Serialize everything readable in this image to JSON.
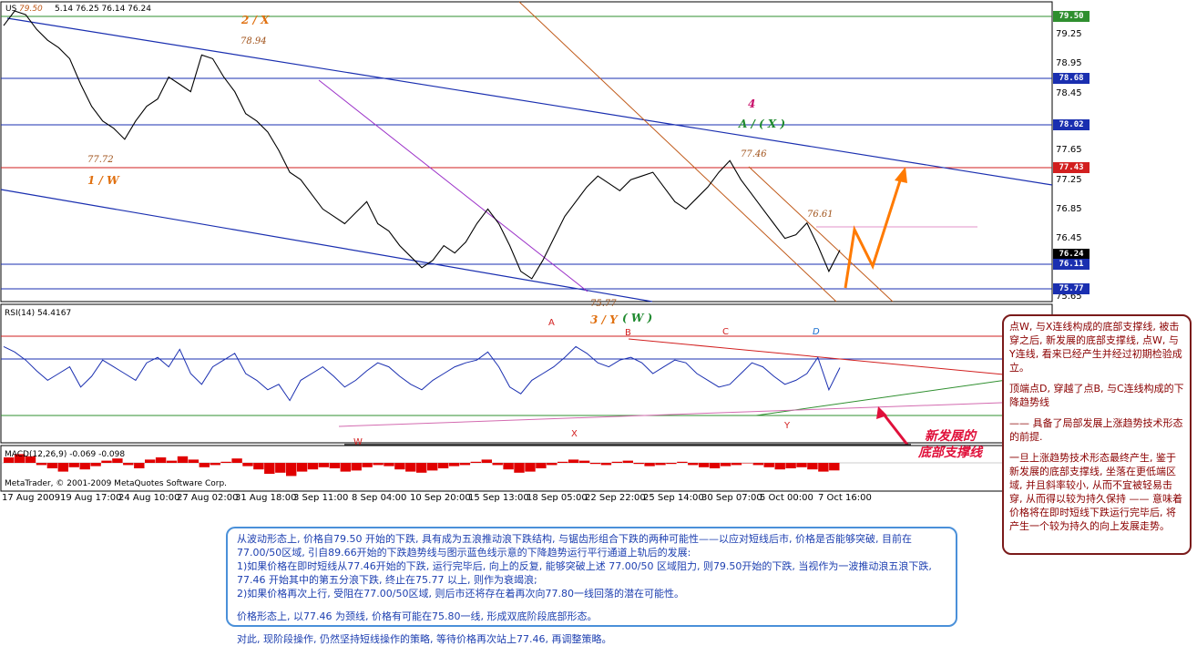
{
  "header": {
    "symbol": "US",
    "quote": "5.14 76.25 76.14 76.24",
    "high_mark": "79.50"
  },
  "price_axis": {
    "ticks": [
      "79.25",
      "78.95",
      "78.45",
      "77.65",
      "77.25",
      "76.85",
      "76.45",
      "75.65"
    ],
    "tags": [
      {
        "label": "79.50",
        "value": 79.5,
        "color": "#2f8f2f"
      },
      {
        "label": "78.68",
        "value": 78.68,
        "color": "#1a2fb0"
      },
      {
        "label": "78.02",
        "value": 78.02,
        "color": "#1a2fb0"
      },
      {
        "label": "77.43",
        "value": 77.43,
        "color": "#d21f1f"
      },
      {
        "label": "76.24",
        "value": 76.24,
        "color": "#000000"
      },
      {
        "label": "76.11",
        "value": 76.11,
        "color": "#1a2fb0"
      },
      {
        "label": "75.77",
        "value": 75.77,
        "color": "#1a2fb0"
      }
    ]
  },
  "wave_labels": {
    "two_x": "2 / X",
    "p7894": "78.94",
    "p7772": "77.72",
    "one_w": "1 / W",
    "four": "4",
    "a_x": "A / ( X )",
    "p7746": "77.46",
    "p7661": "76.61",
    "p7577": "75.77",
    "three_y": "3 / Y",
    "w_paren": "( W )"
  },
  "rsi": {
    "title": "RSI(14) 54.4167",
    "labels": {
      "A": "A",
      "B": "B",
      "C": "C",
      "D": "D",
      "W": "W",
      "X": "X",
      "Y": "Y"
    }
  },
  "macd": {
    "title": "MACD(12,26,9) -0.069 -0.098",
    "copyright": "MetaTrader, © 2001-2009 MetaQuotes Software Corp."
  },
  "time_axis": [
    "17 Aug 2009",
    "19 Aug 17:00",
    "24 Aug 10:00",
    "27 Aug 02:00",
    "31 Aug 18:00",
    "3 Sep 11:00",
    "8 Sep 04:00",
    "10 Sep 20:00",
    "15 Sep 13:00",
    "18 Sep 05:00",
    "22 Sep 22:00",
    "25 Sep 14:00",
    "30 Sep 07:00",
    "5 Oct 00:00",
    "7 Oct 16:00"
  ],
  "callout": {
    "line1": "新发展的",
    "line2": "底部支撑线"
  },
  "right_notes": [
    "点W, 与X连线构成的底部支撑线, 被击穿之后, 新发展的底部支撑线, 点W, 与Y连线, 看来已经产生并经过初期检验成立。",
    "顶端点D, 穿越了点B, 与C连线构成的下降趋势线",
    "—— 具备了局部发展上涨趋势技术形态的前提.",
    "一旦上涨趋势技术形态最终产生, 鉴于新发展的底部支撑线, 坐落在更低端区域, 并且斜率较小, 从而不宜被轻易击穿, 从而得以较为持久保持 —— 意味着价格将在即时短线下跌运行完毕后, 将产生一个较为持久的向上发展走势。"
  ],
  "bottom_comment": [
    "从波动形态上, 价格自79.50 开始的下跌, 具有成为五浪推动浪下跌结构, 与锯齿形组合下跌的两种可能性——以应对短线后市, 价格是否能够突破, 目前在77.00/50区域, 引自89.66开始的下跌趋势线与图示蓝色线示意的下降趋势运行平行通道上轨后的发展:",
    "1)如果价格在即时短线从77.46开始的下跌, 运行完毕后, 向上的反复, 能够突破上述 77.00/50 区域阻力, 则79.50开始的下跌, 当视作为一波推动浪五浪下跌, 77.46 开始其中的第五分浪下跌, 终止在75.77 以上, 则作为衰竭浪;",
    "2)如果价格再次上行, 受阻在77.00/50区域, 则后市还将存在着再次向77.80一线回落的潜在可能性。",
    "",
    "价格形态上, 以77.46 为颈线, 价格有可能在75.80一线, 形成双底阶段底部形态。",
    "",
    "对此, 现阶段操作, 仍然坚持短线操作的策略, 等待价格再次站上77.46, 再调整策略。"
  ],
  "chart_data": [
    {
      "type": "line",
      "title": "US",
      "series": [
        {
          "values": [
            79.3,
            79.5,
            79.45,
            79.25,
            79.1,
            79.0,
            78.85,
            78.5,
            78.2,
            78.0,
            77.9,
            77.75,
            78.0,
            78.2,
            78.3,
            78.6,
            78.5,
            78.4,
            78.9,
            78.85,
            78.6,
            78.4,
            78.1,
            78.0,
            77.85,
            77.6,
            77.3,
            77.2,
            77.0,
            76.8,
            76.7,
            76.6,
            76.75,
            76.9,
            76.6,
            76.5,
            76.3,
            76.15,
            76.0,
            76.1,
            76.3,
            76.2,
            76.35,
            76.6,
            76.8,
            76.6,
            76.3,
            75.95,
            75.85,
            76.1,
            76.4,
            76.7,
            76.9,
            77.1,
            77.25,
            77.15,
            77.05,
            77.2,
            77.25,
            77.3,
            77.1,
            76.9,
            76.8,
            76.95,
            77.1,
            77.3,
            77.46,
            77.2,
            77.0,
            76.8,
            76.6,
            76.4,
            76.45,
            76.61,
            76.3,
            75.95,
            76.24
          ]
        }
      ],
      "ylim": [
        75.55,
        79.6
      ]
    },
    {
      "type": "line",
      "title": "RSI(14) 54.4167",
      "series": [
        {
          "name": "RSI(14)",
          "values": [
            70,
            66,
            60,
            52,
            45,
            50,
            55,
            40,
            48,
            60,
            55,
            50,
            45,
            58,
            62,
            55,
            68,
            50,
            42,
            55,
            60,
            65,
            50,
            45,
            38,
            42,
            30,
            45,
            50,
            55,
            48,
            40,
            45,
            52,
            58,
            55,
            48,
            42,
            38,
            45,
            50,
            55,
            58,
            60,
            66,
            55,
            40,
            35,
            45,
            50,
            55,
            62,
            70,
            65,
            58,
            55,
            60,
            62,
            58,
            50,
            55,
            60,
            58,
            50,
            45,
            40,
            42,
            50,
            58,
            55,
            48,
            42,
            45,
            50,
            62,
            38,
            54.4
          ]
        }
      ]
    },
    {
      "type": "bar",
      "title": "MACD(12,26,9) -0.069 -0.098",
      "series": [
        {
          "name": "MACD",
          "values": [
            0.05,
            0.08,
            0.06,
            -0.02,
            -0.05,
            -0.08,
            -0.04,
            -0.06,
            -0.03,
            0.02,
            0.04,
            -0.02,
            -0.05,
            0.03,
            0.05,
            0.02,
            0.06,
            0.03,
            -0.04,
            -0.02,
            0.01,
            0.04,
            -0.03,
            -0.06,
            -0.1,
            -0.09,
            -0.12,
            -0.08,
            -0.06,
            -0.04,
            -0.05,
            -0.08,
            -0.07,
            -0.04,
            -0.02,
            -0.03,
            -0.06,
            -0.08,
            -0.09,
            -0.07,
            -0.05,
            -0.03,
            -0.02,
            0.01,
            0.03,
            -0.02,
            -0.06,
            -0.09,
            -0.08,
            -0.05,
            -0.02,
            0.01,
            0.03,
            0.02,
            -0.01,
            -0.02,
            0.01,
            0.02,
            -0.01,
            -0.03,
            -0.02,
            -0.01,
            0.01,
            -0.02,
            -0.04,
            -0.05,
            -0.03,
            -0.02,
            0.0,
            -0.02,
            -0.04,
            -0.06,
            -0.05,
            -0.04,
            -0.06,
            -0.08,
            -0.069
          ]
        }
      ]
    }
  ]
}
